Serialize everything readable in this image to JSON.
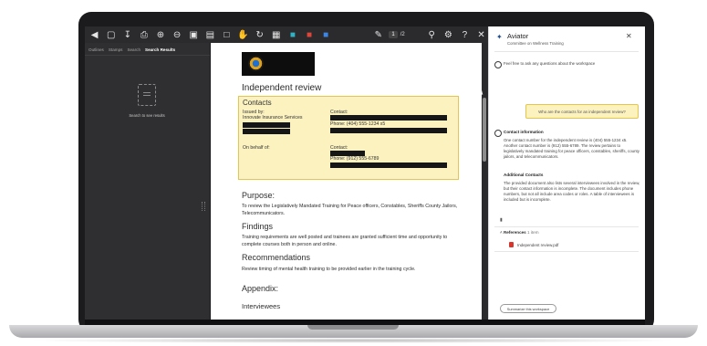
{
  "toolbar": {
    "icons": [
      "panel-icon",
      "sidebar-icon",
      "download-icon",
      "print-icon",
      "zoom-in-icon",
      "zoom-out-icon",
      "fit-icon",
      "page-view-icon",
      "two-page-icon",
      "hand-icon",
      "rotate-icon",
      "crop-icon",
      "teal-app-icon",
      "red-app-icon",
      "blue-app-icon",
      "signature-icon",
      "search-icon",
      "gear-icon",
      "help-icon",
      "close-icon"
    ],
    "page_current": "1",
    "page_total": "/2"
  },
  "left_panel": {
    "tabs": [
      "Outlines",
      "Stamps",
      "Search",
      "Search Results"
    ],
    "active_tab": "Search Results",
    "empty_text": "Search to see results"
  },
  "document": {
    "heading": "Independent review",
    "contacts": {
      "title": "Contacts",
      "issued_by_label": "Issued by:",
      "issuer": "Innovate Insurance Services",
      "contact1_label": "Contact:",
      "contact1_phone": "Phone: (404) 555-1234 x5",
      "on_behalf_label": "On behalf of:",
      "contact2_label": "Contact:",
      "contact2_phone": "Phone: (912) 555-6789"
    },
    "purpose_h": "Purpose:",
    "purpose_p": "To review the Legislatively Mandated Training for Peace officers, Constables, Sheriffs County Jailors, Telecommunicators.",
    "findings_h": "Findings",
    "findings_p": "Training requirements are well posted and trainees are granted sufficient time and opportunity to complete courses both in person and online.",
    "recs_h": "Recommendations",
    "recs_p": "Review timing of mental health training to be provided earlier in the training cycle.",
    "appendix_h": "Appendix:",
    "interviewees_h": "Interviewees"
  },
  "aviator": {
    "title": "Aviator",
    "subtitle": "Committee on Wellness Training",
    "prompt_hint": "Feel free to ask any questions about the workspace",
    "question": "Who are the contacts for an independent review?",
    "answer_title": "Contact information",
    "answer_p": "One contact number for the independent review is (404) 555-1234 x5. Another contact number is (912) 555-6789. The review pertains to legislatively mandated training for peace officers, constables, sheriffs, county jailors, and telecommunicators.",
    "additional_title": "Additional Contacts",
    "additional_p": "The provided document also lists several interviewees involved in the review, but their contact information is incomplete. The document includes phone numbers, but not all include area codes or roles. A table of interviewees is included but is incomplete.",
    "references_label": "References",
    "references_count": "1 item",
    "reference_file": "Independent review.pdf",
    "summarize_button": "Summarize this workspace"
  },
  "colors": {
    "highlight_fill": "#fbf2c0",
    "highlight_border": "#e5c64c",
    "toolbar_bg": "#2b2b2e",
    "pdf_red": "#d9352c"
  }
}
